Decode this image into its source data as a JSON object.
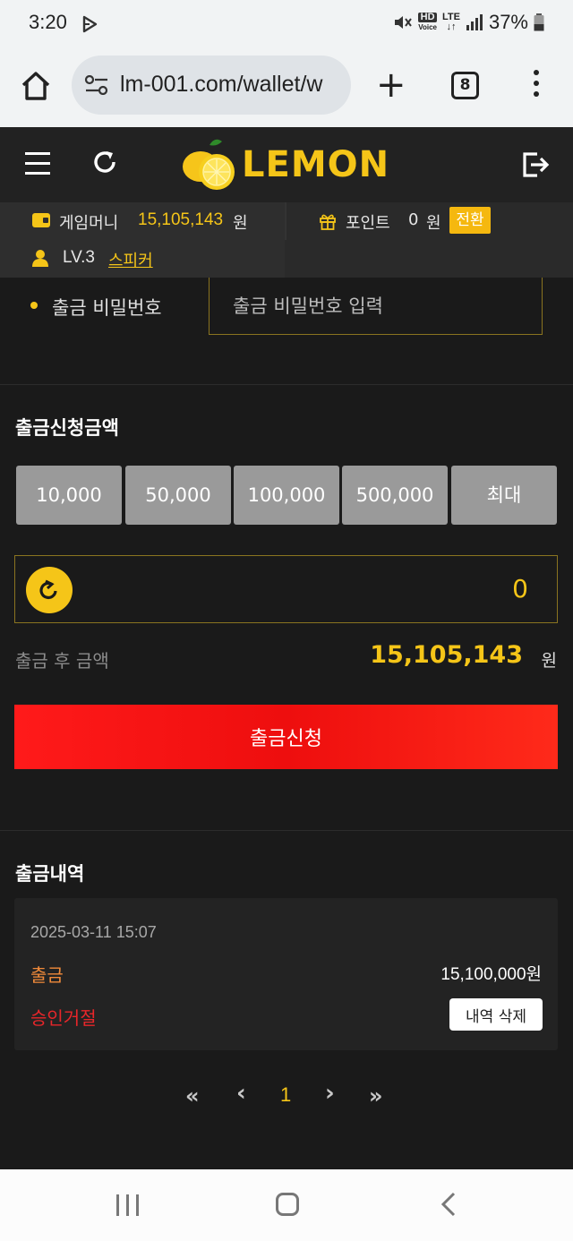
{
  "status_bar": {
    "time": "3:20",
    "battery": "37%",
    "icons": [
      "play-icon",
      "mute-icon",
      "hd-voice-icon",
      "lte-icon",
      "signal-icon",
      "battery-icon"
    ],
    "hd_top": "HD",
    "hd_bottom": "Voice",
    "lte": "LTE"
  },
  "browser": {
    "url": "lm-001.com/wallet/w",
    "tab_count": "8"
  },
  "header": {
    "logo_text": "LEMON",
    "colors": {
      "accent": "#f5c518",
      "background": "#222222"
    }
  },
  "info": {
    "game_money_label": "게임머니",
    "game_money_value": "15,105,143",
    "game_money_unit": "원",
    "point_label": "포인트",
    "point_value": "0",
    "point_unit": "원",
    "convert_label": "전환",
    "level": "LV.3",
    "nickname": "스피커"
  },
  "password": {
    "label": "출금 비밀번호",
    "placeholder": "출금 비밀번호 입력"
  },
  "withdraw": {
    "section_title": "출금신청금액",
    "amount_buttons": [
      "10,000",
      "50,000",
      "100,000",
      "500,000",
      "최대"
    ],
    "amount_value": "0",
    "after_label": "출금 후 금액",
    "after_value": "15,105,143",
    "after_unit": "원",
    "submit_label": "출금신청",
    "colors": {
      "submit": "#ff1a1a"
    }
  },
  "history": {
    "section_title": "출금내역",
    "items": [
      {
        "date": "2025-03-11 15:07",
        "type": "출금",
        "amount": "15,100,000원",
        "status": "승인거절",
        "delete_label": "내역 삭제"
      }
    ]
  },
  "pagination": {
    "first": "«",
    "prev": "‹",
    "current": "1",
    "next": "›",
    "last": "»"
  }
}
